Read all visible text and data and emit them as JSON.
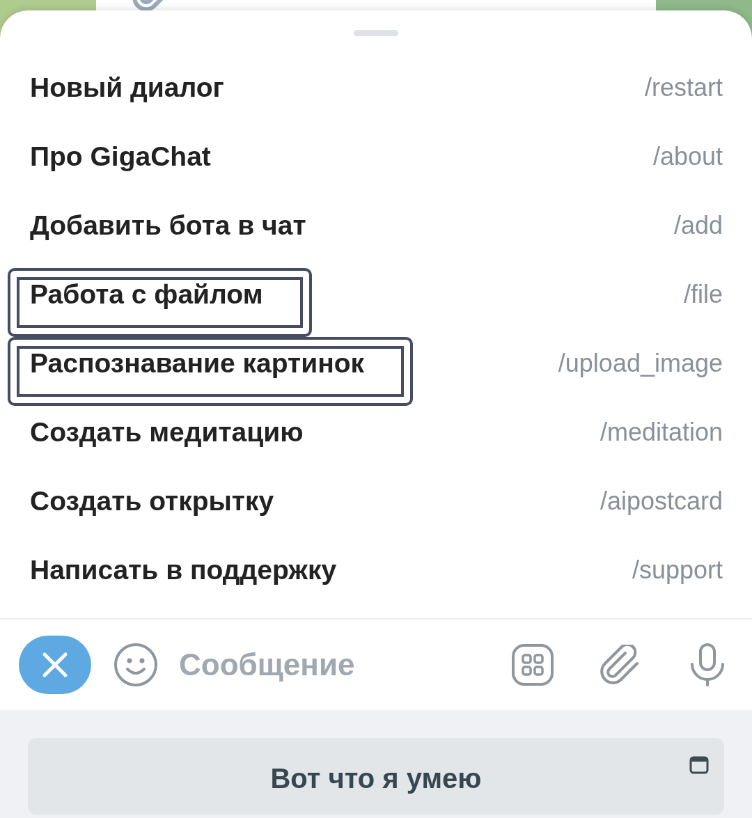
{
  "command_menu": {
    "items": [
      {
        "title": "Новый диалог",
        "command": "/restart",
        "highlighted": false
      },
      {
        "title": "Про GigaChat",
        "command": "/about",
        "highlighted": false
      },
      {
        "title": "Добавить бота в чат",
        "command": "/add",
        "highlighted": false
      },
      {
        "title": "Работа с файлом",
        "command": "/file",
        "highlighted": true
      },
      {
        "title": "Распознавание картинок",
        "command": "/upload_image",
        "highlighted": true
      },
      {
        "title": "Создать медитацию",
        "command": "/meditation",
        "highlighted": false
      },
      {
        "title": "Создать открытку",
        "command": "/aipostcard",
        "highlighted": false
      },
      {
        "title": "Написать в поддержку",
        "command": "/support",
        "highlighted": false
      }
    ]
  },
  "composer": {
    "placeholder": "Сообщение"
  },
  "reply_keyboard": {
    "buttons": [
      {
        "label": "Вот что я умею"
      }
    ]
  }
}
